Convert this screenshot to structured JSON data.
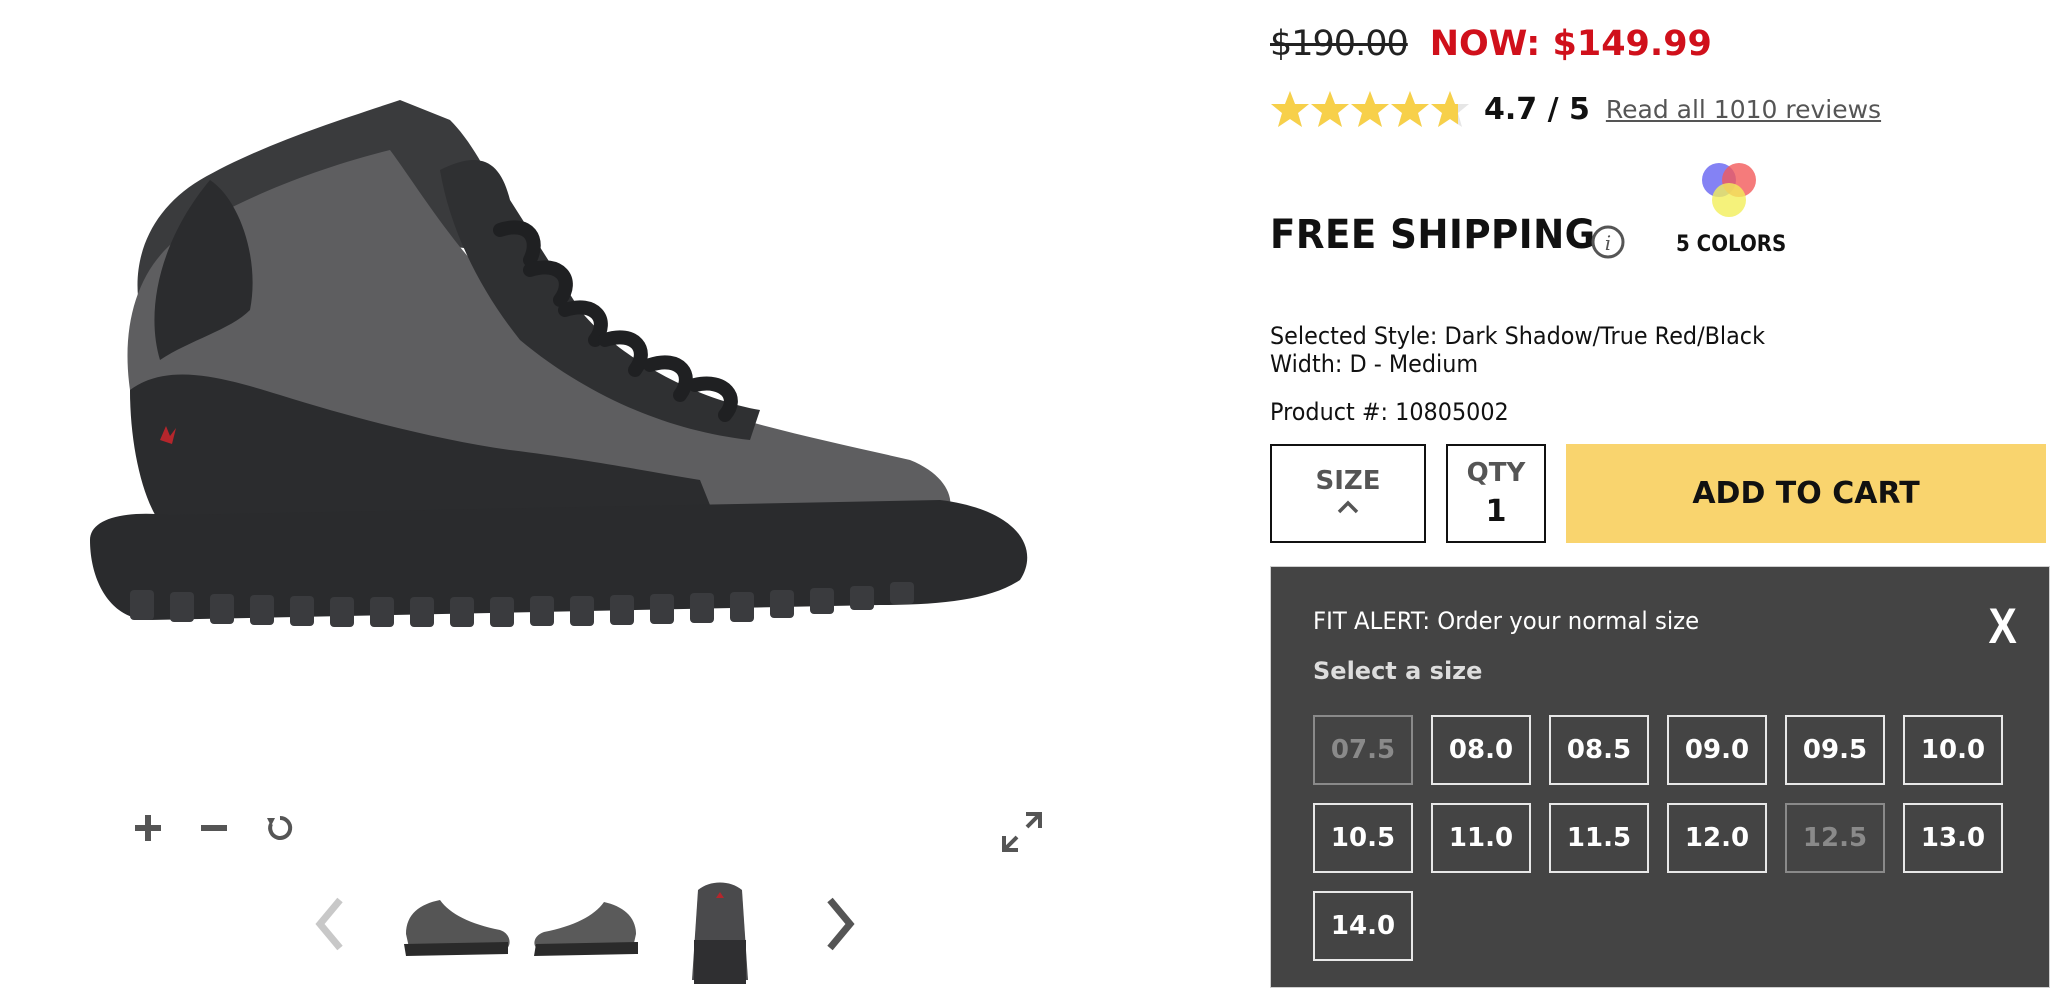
{
  "pricing": {
    "was_price": "$190.00",
    "now_price": "NOW: $149.99"
  },
  "rating": {
    "value": 4.7,
    "max": 5,
    "text": "4.7 / 5",
    "reviews_link": "Read all 1010 reviews",
    "star_color": "#f7d04a"
  },
  "shipping": {
    "label": "FREE SHIPPING",
    "info_icon": "info-icon"
  },
  "colors": {
    "label": "5 COLORS",
    "swatch_icon": "color-swatch-icon"
  },
  "product": {
    "selected_style": "Selected Style: Dark Shadow/True Red/Black",
    "width": "Width: D - Medium",
    "product_number": "Product #: 10805002"
  },
  "purchase": {
    "size_label": "SIZE",
    "qty_label": "QTY",
    "qty_value": "1",
    "add_to_cart": "ADD TO CART",
    "accent_color": "#f9d46e",
    "sale_color": "#d0101b"
  },
  "size_panel": {
    "fit_alert": "FIT ALERT: Order your normal size",
    "close_label": "X",
    "select_label": "Select a size",
    "background": "#444444",
    "sizes": [
      {
        "label": "07.5",
        "available": false
      },
      {
        "label": "08.0",
        "available": true
      },
      {
        "label": "08.5",
        "available": true
      },
      {
        "label": "09.0",
        "available": true
      },
      {
        "label": "09.5",
        "available": true
      },
      {
        "label": "10.0",
        "available": true
      },
      {
        "label": "10.5",
        "available": true
      },
      {
        "label": "11.0",
        "available": true
      },
      {
        "label": "11.5",
        "available": true
      },
      {
        "label": "12.0",
        "available": true
      },
      {
        "label": "12.5",
        "available": false
      },
      {
        "label": "13.0",
        "available": true
      },
      {
        "label": "14.0",
        "available": true
      }
    ]
  },
  "viewer": {
    "controls": [
      "zoom-in-icon",
      "zoom-out-icon",
      "reset-icon",
      "expand-icon"
    ],
    "thumbnails": [
      "shoe-side-view",
      "shoe-medial-view",
      "shoe-back-view"
    ]
  }
}
